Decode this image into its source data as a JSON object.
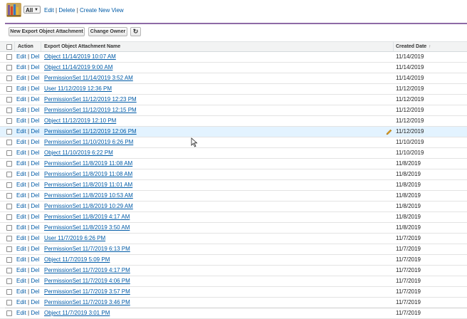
{
  "viewbar": {
    "selected_view": "All",
    "links": [
      "Edit",
      "Delete",
      "Create New View"
    ]
  },
  "buttons": {
    "new_export": "New Export Object Attachment",
    "change_owner": "Change Owner",
    "refresh_glyph": "↻"
  },
  "table": {
    "headers": {
      "action": "Action",
      "name": "Export Object Attachment Name",
      "created": "Created Date"
    },
    "sort_indicator": "↑",
    "action_edit": "Edit",
    "action_sep": "|",
    "action_del": "Del",
    "rows": [
      {
        "name": "Object 11/14/2019 10:07 AM",
        "date": "11/14/2019"
      },
      {
        "name": "Object 11/14/2019 9:00 AM",
        "date": "11/14/2019"
      },
      {
        "name": "PermissionSet 11/14/2019 3:52 AM",
        "date": "11/14/2019"
      },
      {
        "name": "User 11/12/2019 12:36 PM",
        "date": "11/12/2019"
      },
      {
        "name": "PermissionSet 11/12/2019 12:23 PM",
        "date": "11/12/2019"
      },
      {
        "name": "PermissionSet 11/12/2019 12:15 PM",
        "date": "11/12/2019"
      },
      {
        "name": "Object 11/12/2019 12:10 PM",
        "date": "11/12/2019"
      },
      {
        "name": "PermissionSet 11/12/2019 12:06 PM",
        "date": "11/12/2019"
      },
      {
        "name": "PermissionSet 11/10/2019 6:26 PM",
        "date": "11/10/2019"
      },
      {
        "name": "Object 11/10/2019 6:22 PM",
        "date": "11/10/2019"
      },
      {
        "name": "PermissionSet 11/8/2019 11:08 AM",
        "date": "11/8/2019"
      },
      {
        "name": "PermissionSet 11/8/2019 11:08 AM",
        "date": "11/8/2019"
      },
      {
        "name": "PermissionSet 11/8/2019 11:01 AM",
        "date": "11/8/2019"
      },
      {
        "name": "PermissionSet 11/8/2019 10:53 AM",
        "date": "11/8/2019"
      },
      {
        "name": "PermissionSet 11/8/2019 10:29 AM",
        "date": "11/8/2019"
      },
      {
        "name": "PermissionSet 11/8/2019 4:17 AM",
        "date": "11/8/2019"
      },
      {
        "name": "PermissionSet 11/8/2019 3:50 AM",
        "date": "11/8/2019"
      },
      {
        "name": "User 11/7/2019 6:26 PM",
        "date": "11/7/2019"
      },
      {
        "name": "PermissionSet 11/7/2019 6:13 PM",
        "date": "11/7/2019"
      },
      {
        "name": "Object 11/7/2019 5:09 PM",
        "date": "11/7/2019"
      },
      {
        "name": "PermissionSet 11/7/2019 4:17 PM",
        "date": "11/7/2019"
      },
      {
        "name": "PermissionSet 11/7/2019 4:06 PM",
        "date": "11/7/2019"
      },
      {
        "name": "PermissionSet 11/7/2019 3:57 PM",
        "date": "11/7/2019"
      },
      {
        "name": "PermissionSet 11/7/2019 3:46 PM",
        "date": "11/7/2019"
      },
      {
        "name": "Object 11/7/2019 3:01 PM",
        "date": "11/7/2019"
      }
    ],
    "highlighted_row": 7
  },
  "colors": {
    "link": "#015ba7",
    "accent_line": "#8e6aa6",
    "row_highlight": "#e3f3ff",
    "header_bg": "#f2f3f3"
  },
  "icons": [
    "app-logo-icon",
    "dropdown-caret-icon",
    "refresh-icon",
    "pencil-edit-icon",
    "mouse-cursor-icon"
  ]
}
